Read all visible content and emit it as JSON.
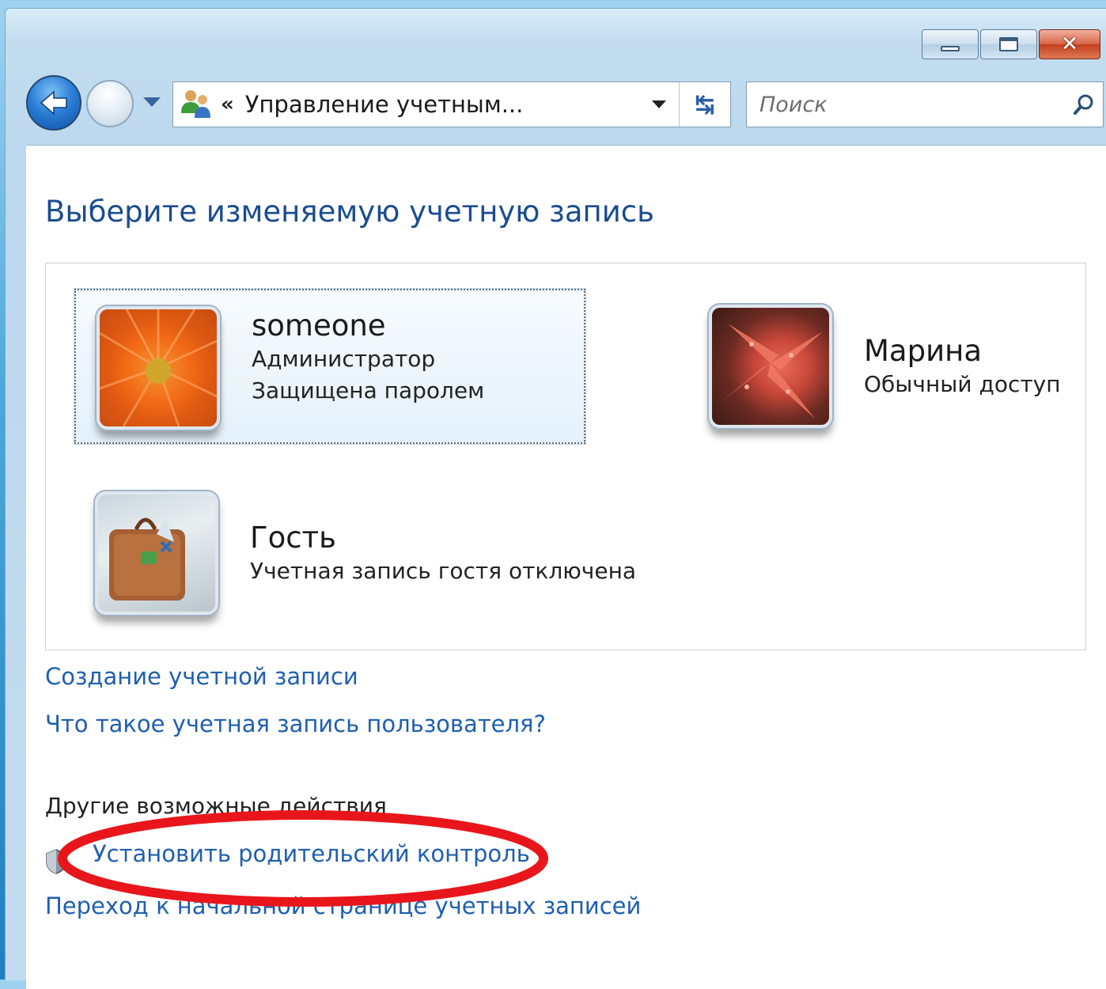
{
  "window": {
    "address": "Управление учетным...",
    "address_prefix": "«",
    "search_placeholder": "Поиск",
    "caption_buttons": [
      "minimize",
      "maximize",
      "close"
    ]
  },
  "main": {
    "title": "Выберите изменяемую учетную запись",
    "accounts": [
      {
        "name": "someone",
        "lines": [
          "Администратор",
          "Защищена паролем"
        ],
        "picture": "orange-flower",
        "selected": true
      },
      {
        "name": "Марина",
        "lines": [
          "Обычный доступ"
        ],
        "picture": "starfish",
        "selected": false
      },
      {
        "name": "Гость",
        "lines": [
          "Учетная запись гостя отключена"
        ],
        "picture": "suitcase",
        "selected": false
      }
    ],
    "links": {
      "create_account": "Создание учетной записи",
      "what_is_account": "Что такое учетная запись пользователя?"
    },
    "other_actions": {
      "label": "Другие возможные действия",
      "parental_control": "Установить родительский контроль",
      "go_home": "Переход к начальной странице учетных записей"
    }
  },
  "annotation": {
    "shape": "ellipse",
    "color": "#e8161b",
    "target": "parental_control"
  },
  "colors": {
    "link": "#1f5fb0",
    "title": "#1b4c8f",
    "window_frame": "#c3ddef"
  },
  "icons": [
    "back-icon",
    "forward-icon",
    "users-icon",
    "refresh-icon",
    "search-icon",
    "shield-icon"
  ]
}
